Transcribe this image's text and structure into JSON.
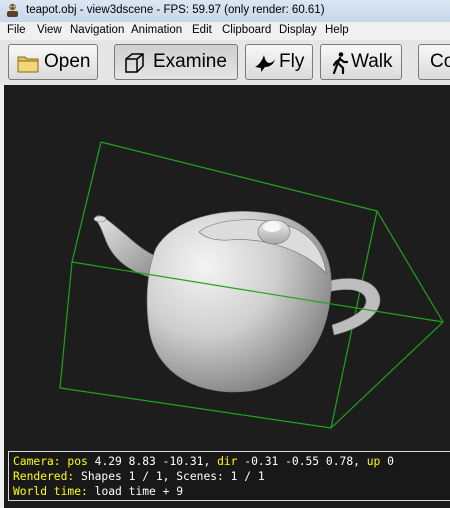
{
  "window": {
    "title": "teapot.obj - view3dscene - FPS: 59.97 (only render: 60.61)"
  },
  "menu": {
    "items": [
      "File",
      "View",
      "Navigation",
      "Animation",
      "Edit",
      "Clipboard",
      "Display",
      "Help"
    ]
  },
  "toolbar": {
    "open_label": "Open",
    "examine_label": "Examine",
    "fly_label": "Fly",
    "walk_label": "Walk",
    "partial_label": "Co",
    "active_mode": "Examine",
    "icons": {
      "open": "folder-icon",
      "examine": "cube-icon",
      "fly": "bird-icon",
      "walk": "walking-person-icon"
    }
  },
  "scene": {
    "model": "teapot",
    "background_color": "#1d1d1d",
    "bounding_box_color": "#1fa31f",
    "model_color": "#c4c4c4"
  },
  "status": {
    "camera_label": "Camera:",
    "pos_label": "pos",
    "pos_value": "4.29 8.83 -10.31,",
    "dir_label": "dir",
    "dir_value": "-0.31 -0.55 0.78,",
    "up_label": "up",
    "up_value": "0",
    "rendered_label": "Rendered:",
    "rendered_value": "Shapes 1 / 1, Scenes: 1 / 1",
    "world_time_label": "World time:",
    "world_time_value": "load time + 9",
    "label_color": "#ffff00",
    "value_color": "#ffffff"
  }
}
